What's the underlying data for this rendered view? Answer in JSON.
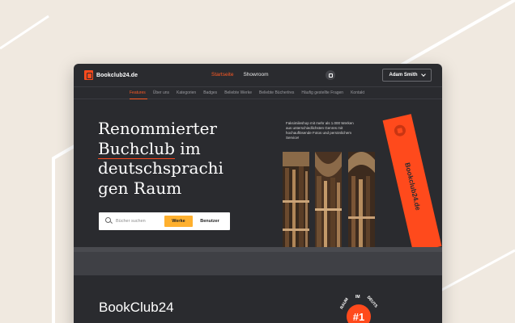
{
  "header": {
    "logo_text": "Bookclub24.de",
    "nav": [
      {
        "label": "Startseite",
        "active": true
      },
      {
        "label": "Showroom",
        "active": false
      }
    ],
    "user_button": "Adam Smith"
  },
  "subnav": {
    "items": [
      {
        "label": "Features",
        "active": true
      },
      {
        "label": "Über uns",
        "active": false
      },
      {
        "label": "Kategorien",
        "active": false
      },
      {
        "label": "Badges",
        "active": false
      },
      {
        "label": "Beliebte Werke",
        "active": false
      },
      {
        "label": "Beliebte Bücherlres",
        "active": false
      },
      {
        "label": "Häufig gestellte Fragen",
        "active": false
      },
      {
        "label": "Kontakt",
        "active": false
      }
    ]
  },
  "hero": {
    "headline_line1": "Renommierter",
    "headline_word_highlight": "Buchclub",
    "headline_line2_rest": " im",
    "headline_line3": "deutschsprachi",
    "headline_line4": "gen Raum",
    "search_placeholder": "Bücher suchen",
    "search_tab_active": "Werke",
    "search_tab_inactive": "Benutzer",
    "facsimile_text": "Faksimileshop mit mehr als 1.000 Werken aus unterschiedlichsten Genres mit hochauflösende Fotos und persönlichem Service!",
    "bookmark_text": "Bookclub24.de"
  },
  "lower": {
    "brand_title": "BookClub24",
    "badge_number": "#1",
    "badge_word_left": "RAUM",
    "badge_word_top": "IM",
    "badge_word_right": "DEUTS"
  },
  "colors": {
    "accent": "#ff4a1c",
    "background": "#f0e9e0",
    "window": "#2a2b2f",
    "search_tab": "#ffb02e"
  }
}
